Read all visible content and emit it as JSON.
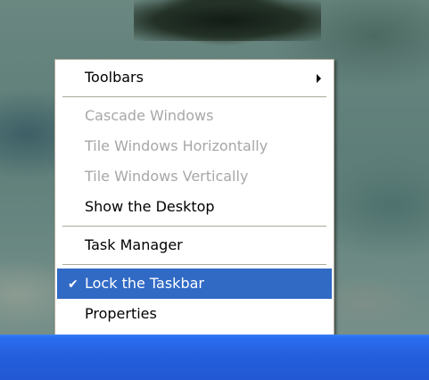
{
  "context_menu": {
    "items": [
      {
        "label": "Toolbars",
        "enabled": true,
        "submenu": true
      },
      {
        "label": "Cascade Windows",
        "enabled": false
      },
      {
        "label": "Tile Windows Horizontally",
        "enabled": false
      },
      {
        "label": "Tile Windows Vertically",
        "enabled": false
      },
      {
        "label": "Show the Desktop",
        "enabled": true
      },
      {
        "label": "Task Manager",
        "enabled": true
      },
      {
        "label": "Lock the Taskbar",
        "enabled": true,
        "checked": true,
        "highlighted": true
      },
      {
        "label": "Properties",
        "enabled": true
      }
    ],
    "check_glyph": "✔"
  },
  "colors": {
    "highlight": "#316ac5",
    "disabled_text": "#a7a7a7",
    "taskbar": "#245edb",
    "menu_border": "#aca899"
  },
  "icons": {
    "submenu": "chevron-right-icon",
    "check": "checkmark-icon"
  }
}
